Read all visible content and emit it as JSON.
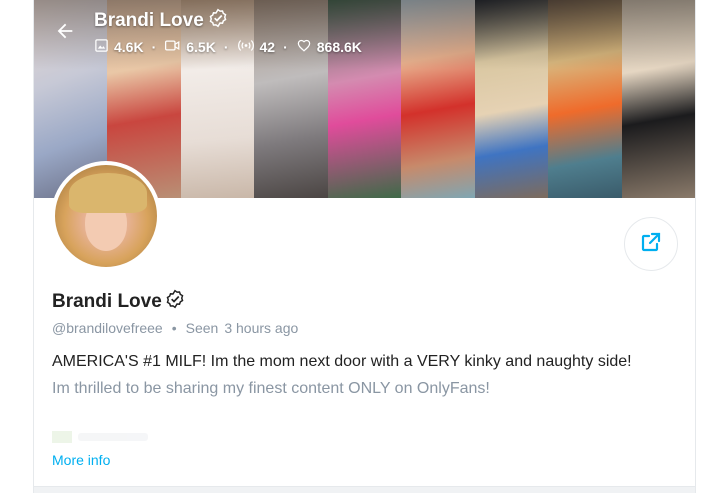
{
  "header": {
    "name": "Brandi Love",
    "stats": {
      "photos": "4.6K",
      "videos": "6.5K",
      "streams": "42",
      "likes": "868.6K"
    }
  },
  "profile": {
    "name": "Brandi Love",
    "username": "@brandilovefreee",
    "seen_label": "Seen",
    "seen_time": "3 hours ago",
    "bio_line1": "AMERICA'S #1 MILF! Im the mom next door with a VERY kinky and naughty side!",
    "bio_line2": "Im thrilled to be sharing my finest content ONLY on OnlyFans!",
    "more_info_label": "More info"
  },
  "icons": {
    "back": "arrow-left-icon",
    "verified": "verified-badge-icon",
    "photos": "image-icon",
    "videos": "video-camera-icon",
    "streams": "broadcast-icon",
    "likes": "heart-icon",
    "share": "share-icon"
  },
  "colors": {
    "accent": "#00aff0",
    "muted_text": "#8a96a3",
    "primary_text": "#222222",
    "border": "#e6e9ec"
  }
}
